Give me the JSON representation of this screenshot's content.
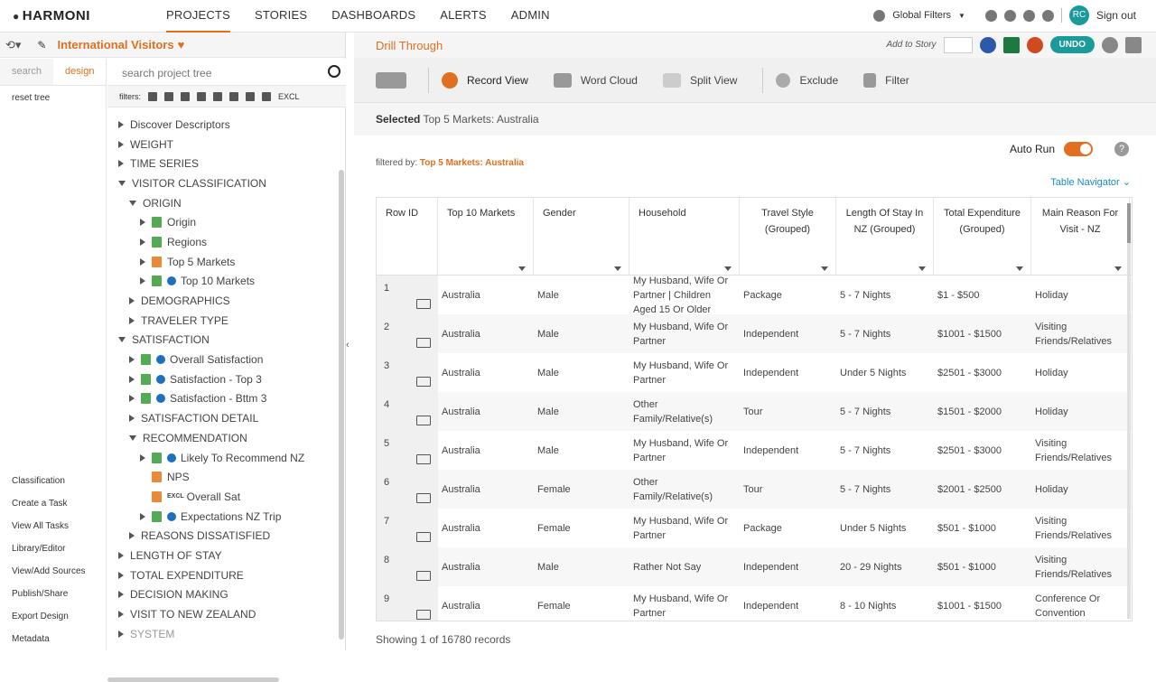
{
  "app": {
    "logo": "HARMONI"
  },
  "nav": [
    "PROJECTS",
    "STORIES",
    "DASHBOARDS",
    "ALERTS",
    "ADMIN"
  ],
  "topright": {
    "global_filters": "Global Filters",
    "avatar": "RC",
    "signout": "Sign out"
  },
  "left": {
    "title": "International Visitors",
    "tabs": [
      "search",
      "design"
    ],
    "reset": "reset tree",
    "search_placeholder": "search project tree",
    "filters_label": "filters:",
    "excl": "EXCL",
    "bottom_links": [
      "Classification",
      "Create a Task",
      "View All Tasks",
      "Library/Editor",
      "View/Add Sources",
      "Publish/Share",
      "Export Design",
      "Metadata"
    ],
    "tree": [
      {
        "label": "Discover Descriptors",
        "indent": 0,
        "exp": "c"
      },
      {
        "label": "WEIGHT",
        "indent": 0,
        "exp": "c"
      },
      {
        "label": "TIME SERIES",
        "indent": 0,
        "exp": "c"
      },
      {
        "label": "VISITOR CLASSIFICATION",
        "indent": 0,
        "exp": "o"
      },
      {
        "label": "ORIGIN",
        "indent": 1,
        "exp": "o"
      },
      {
        "label": "Origin",
        "indent": 2,
        "exp": "c",
        "icon": "g"
      },
      {
        "label": "Regions",
        "indent": 2,
        "exp": "c",
        "icon": "g"
      },
      {
        "label": "Top 5 Markets",
        "indent": 2,
        "exp": "c",
        "icon": "o"
      },
      {
        "label": "Top 10 Markets",
        "indent": 2,
        "exp": "c",
        "icon": "g",
        "info": true
      },
      {
        "label": "DEMOGRAPHICS",
        "indent": 1,
        "exp": "c"
      },
      {
        "label": "TRAVELER TYPE",
        "indent": 1,
        "exp": "c"
      },
      {
        "label": "SATISFACTION",
        "indent": 0,
        "exp": "o"
      },
      {
        "label": "Overall Satisfaction",
        "indent": 1,
        "exp": "c",
        "icon": "g",
        "info": true
      },
      {
        "label": "Satisfaction - Top 3",
        "indent": 1,
        "exp": "c",
        "icon": "g",
        "info": true
      },
      {
        "label": "Satisfaction - Bttm 3",
        "indent": 1,
        "exp": "c",
        "icon": "g",
        "info": true
      },
      {
        "label": "SATISFACTION DETAIL",
        "indent": 1,
        "exp": "c"
      },
      {
        "label": "RECOMMENDATION",
        "indent": 1,
        "exp": "o"
      },
      {
        "label": "Likely To Recommend NZ",
        "indent": 2,
        "exp": "c",
        "icon": "g",
        "info": true
      },
      {
        "label": "NPS",
        "indent": 2,
        "exp": "n",
        "icon": "o"
      },
      {
        "label": "Overall Sat",
        "indent": 2,
        "exp": "n",
        "icon": "o",
        "excl": true
      },
      {
        "label": "Expectations NZ Trip",
        "indent": 2,
        "exp": "c",
        "icon": "g",
        "info": true
      },
      {
        "label": "REASONS DISSATISFIED",
        "indent": 1,
        "exp": "c"
      },
      {
        "label": "LENGTH OF STAY",
        "indent": 0,
        "exp": "c"
      },
      {
        "label": "TOTAL EXPENDITURE",
        "indent": 0,
        "exp": "c"
      },
      {
        "label": "DECISION MAKING",
        "indent": 0,
        "exp": "c"
      },
      {
        "label": "VISIT TO NEW ZEALAND",
        "indent": 0,
        "exp": "c"
      },
      {
        "label": "SYSTEM",
        "indent": 0,
        "exp": "c"
      }
    ]
  },
  "main": {
    "title": "Drill Through",
    "add_to_story": "Add to Story",
    "undo": "UNDO",
    "toolbar": [
      "Record View",
      "Word Cloud",
      "Split View",
      "Exclude",
      "Filter"
    ],
    "selected_label": "Selected",
    "selected_value": "Top 5 Markets: Australia",
    "autorun": "Auto Run",
    "help": "?",
    "filtered_label": "filtered by:",
    "filtered_value": "Top 5 Markets: Australia",
    "table_navigator": "Table Navigator",
    "columns": [
      "Row ID",
      "Top 10 Markets",
      "Gender",
      "Household",
      "Travel Style (Grouped)",
      "Length Of Stay In NZ (Grouped)",
      "Total Expenditure (Grouped)",
      "Main Reason For Visit - NZ"
    ],
    "rows": [
      [
        "1",
        "Australia",
        "Male",
        "My Husband, Wife Or Partner | Children Aged 15 Or Older",
        "Package",
        "5 - 7 Nights",
        "$1 - $500",
        "Holiday"
      ],
      [
        "2",
        "Australia",
        "Male",
        "My Husband, Wife Or Partner",
        "Independent",
        "5 - 7 Nights",
        "$1001 - $1500",
        "Visiting Friends/Relatives"
      ],
      [
        "3",
        "Australia",
        "Male",
        "My Husband, Wife Or Partner",
        "Independent",
        "Under 5 Nights",
        "$2501 - $3000",
        "Holiday"
      ],
      [
        "4",
        "Australia",
        "Male",
        "Other Family/Relative(s)",
        "Tour",
        "5 - 7 Nights",
        "$1501 - $2000",
        "Holiday"
      ],
      [
        "5",
        "Australia",
        "Male",
        "My Husband, Wife Or Partner",
        "Independent",
        "5 - 7 Nights",
        "$2501 - $3000",
        "Visiting Friends/Relatives"
      ],
      [
        "6",
        "Australia",
        "Female",
        "Other Family/Relative(s)",
        "Tour",
        "5 - 7 Nights",
        "$2001 - $2500",
        "Holiday"
      ],
      [
        "7",
        "Australia",
        "Female",
        "My Husband, Wife Or Partner",
        "Package",
        "Under 5 Nights",
        "$501 - $1000",
        "Visiting Friends/Relatives"
      ],
      [
        "8",
        "Australia",
        "Male",
        "Rather Not Say",
        "Independent",
        "20 - 29 Nights",
        "$501 - $1000",
        "Visiting Friends/Relatives"
      ],
      [
        "9",
        "Australia",
        "Female",
        "My Husband, Wife Or Partner",
        "Independent",
        "8 - 10 Nights",
        "$1001 - $1500",
        "Conference Or Convention"
      ]
    ],
    "showing": "Showing 1 of 16780 records"
  }
}
